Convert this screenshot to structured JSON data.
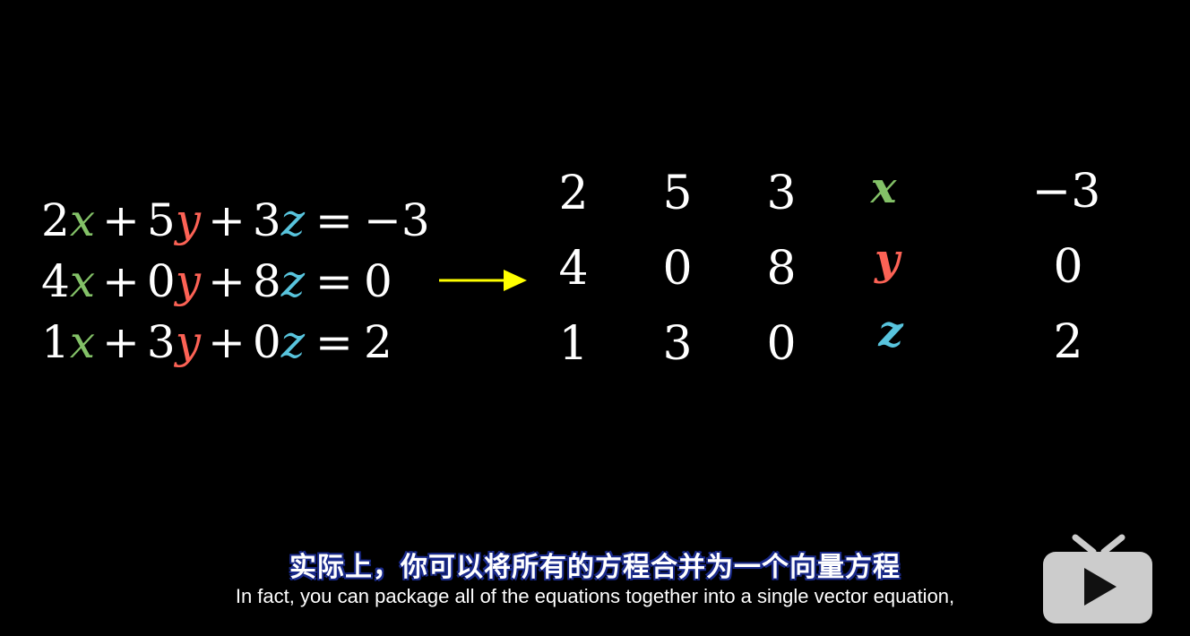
{
  "equations": [
    {
      "c1": "2",
      "c2": "5",
      "c3": "3",
      "rhs": "−3"
    },
    {
      "c1": "4",
      "c2": "0",
      "c3": "8",
      "rhs": "0"
    },
    {
      "c1": "1",
      "c2": "3",
      "c3": "0",
      "rhs": "2"
    }
  ],
  "symbols": {
    "plus": "+",
    "equals": "="
  },
  "variables": {
    "x": "x",
    "y": "y",
    "z": "z"
  },
  "matrix": [
    [
      "2",
      "5",
      "3"
    ],
    [
      "4",
      "0",
      "8"
    ],
    [
      "1",
      "3",
      "0"
    ]
  ],
  "rhs_vector": [
    "−3",
    "0",
    "2"
  ],
  "colors": {
    "x": "#83c167",
    "y": "#fc6255",
    "z": "#58c4dd",
    "arrow": "#ffff00",
    "background": "#000000",
    "subtitle_outline": "#1a2a8a",
    "watermark": "#cccccc"
  },
  "subtitles": {
    "chinese": "实际上，你可以将所有的方程合并为一个向量方程",
    "english": "In fact, you can package all of the equations together into a single vector equation,"
  },
  "watermark": {
    "icon": "tv-play-icon"
  }
}
